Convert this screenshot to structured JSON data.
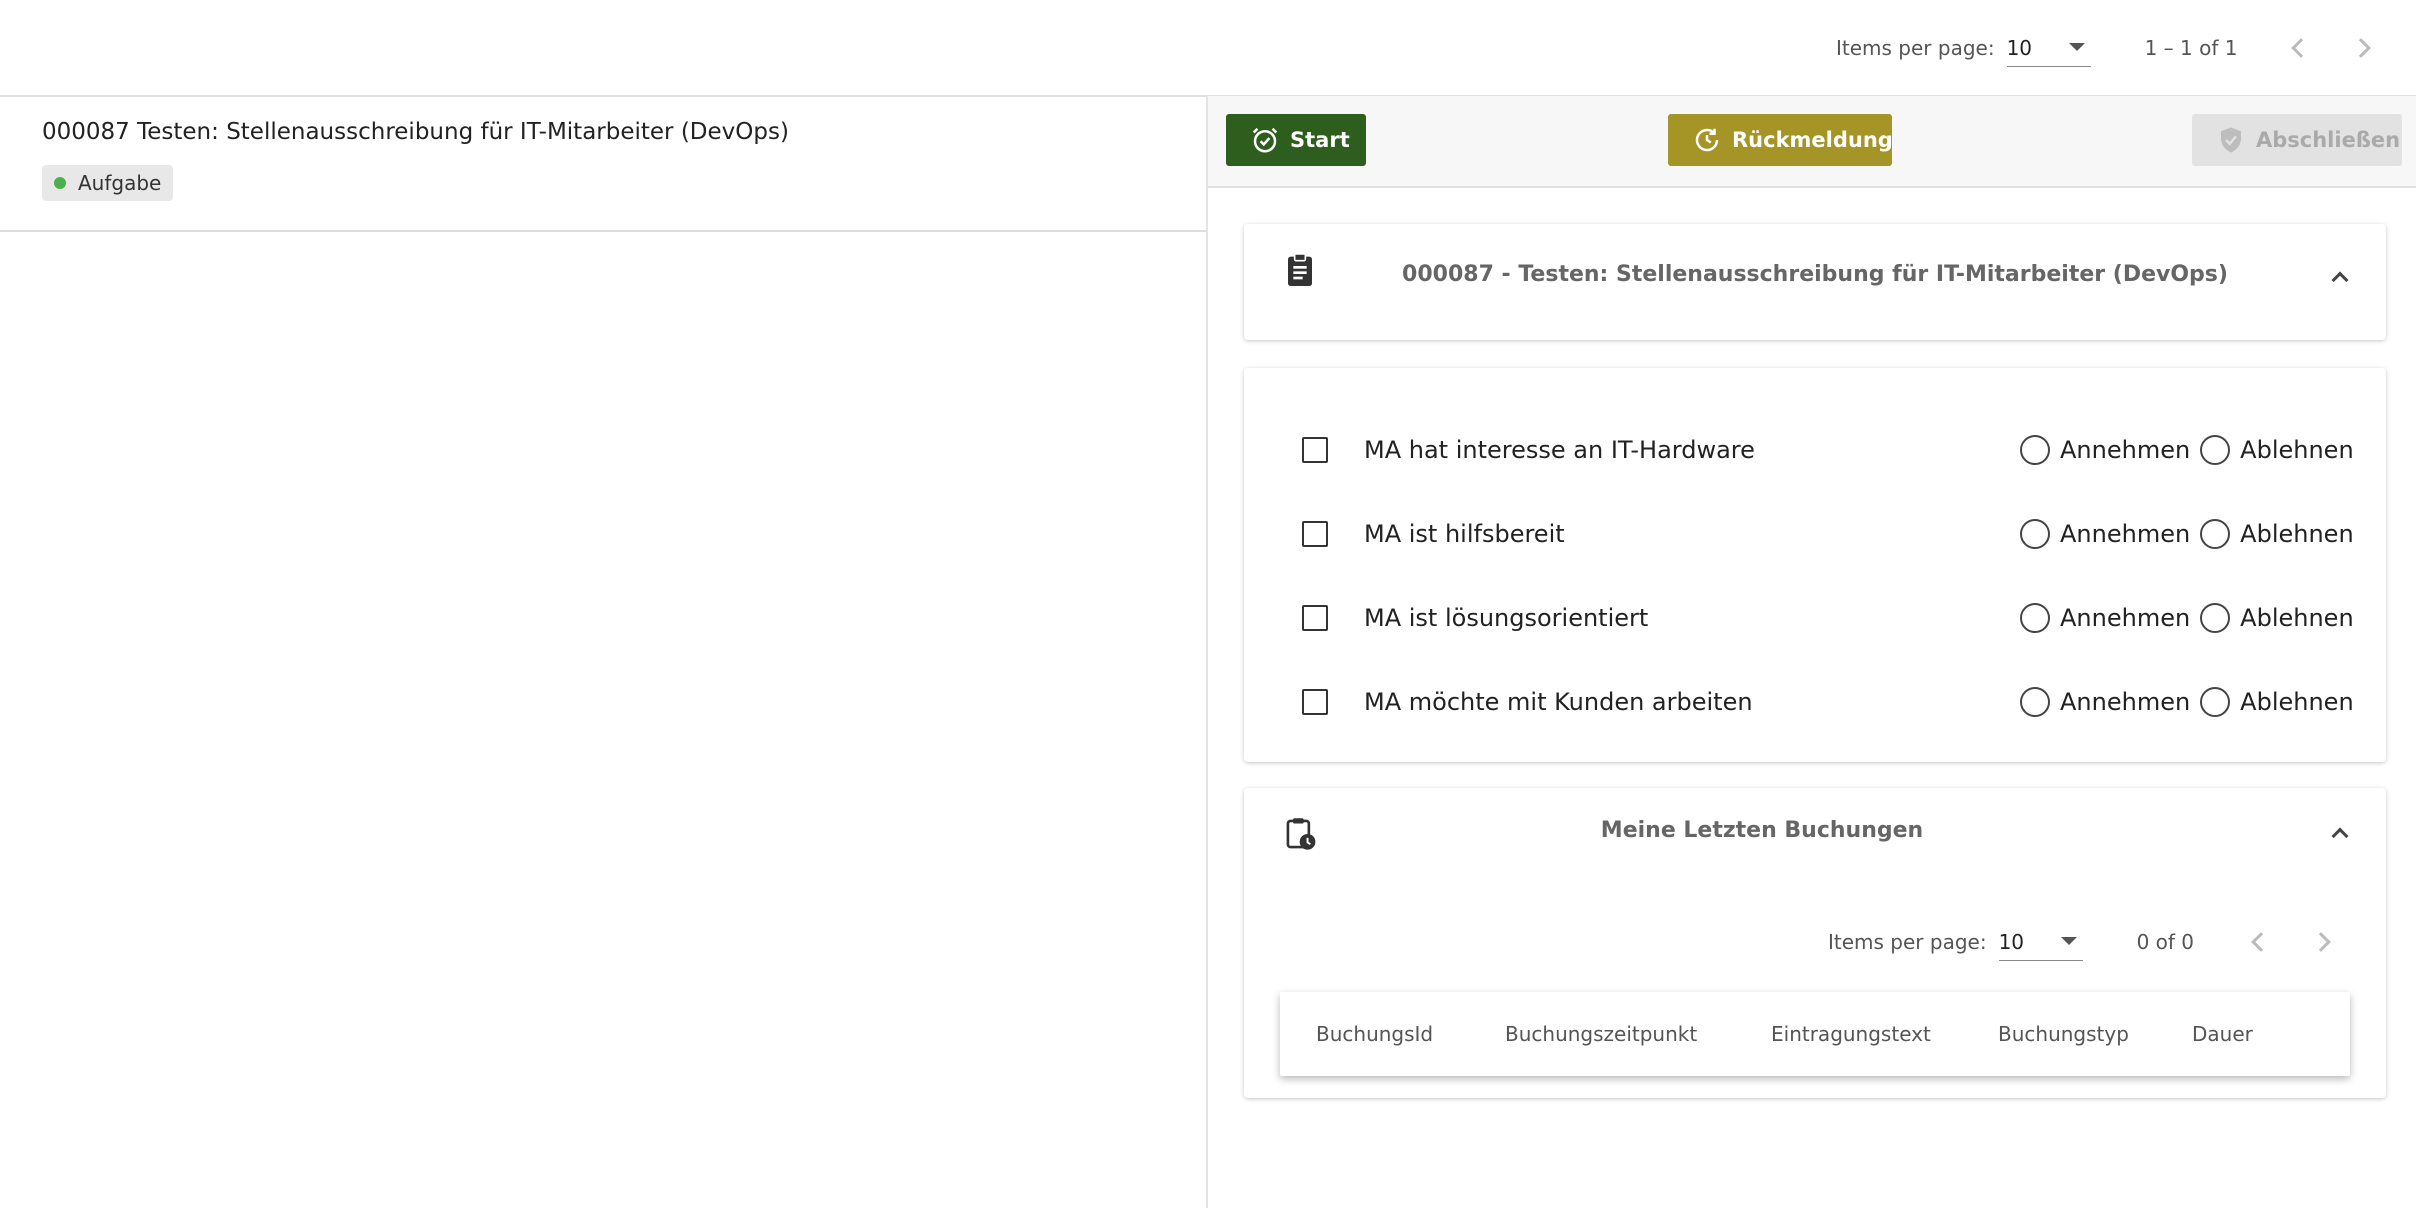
{
  "top_paginator": {
    "items_per_page_label": "Items per page:",
    "items_per_page_value": "10",
    "range_label": "1 – 1 of 1"
  },
  "task": {
    "title": "000087 Testen: Stellenausschreibung für IT-Mitarbeiter (DevOps)",
    "status": "Aufgabe",
    "status_color": "#4caf50"
  },
  "actions": {
    "start_label": "Start",
    "feedback_label": "Rückmeldung",
    "finish_label": "Abschließen"
  },
  "colors": {
    "start_button": "#2e5e1e",
    "feedback_button": "#a49526",
    "finish_button_disabled": "#e2e2e2"
  },
  "task_card": {
    "title": "000087 - Testen: Stellenausschreibung für IT-Mitarbeiter (DevOps)",
    "icon": "clipboard-icon"
  },
  "checklist": {
    "accept_label": "Annehmen",
    "reject_label": "Ablehnen",
    "items": [
      {
        "label": "MA hat interesse an IT-Hardware",
        "checked": false
      },
      {
        "label": "MA ist hilfsbereit",
        "checked": false
      },
      {
        "label": "MA ist lösungsorientiert",
        "checked": false
      },
      {
        "label": "MA möchte mit Kunden arbeiten",
        "checked": false
      }
    ]
  },
  "bookings": {
    "title": "Meine Letzten Buchungen",
    "icon": "clipboard-clock-icon",
    "items_per_page_label": "Items per page:",
    "items_per_page_value": "10",
    "range_label": "0 of 0",
    "columns": [
      "BuchungsId",
      "Buchungszeitpunkt",
      "Eintragungstext",
      "Buchungstyp",
      "Dauer"
    ]
  }
}
